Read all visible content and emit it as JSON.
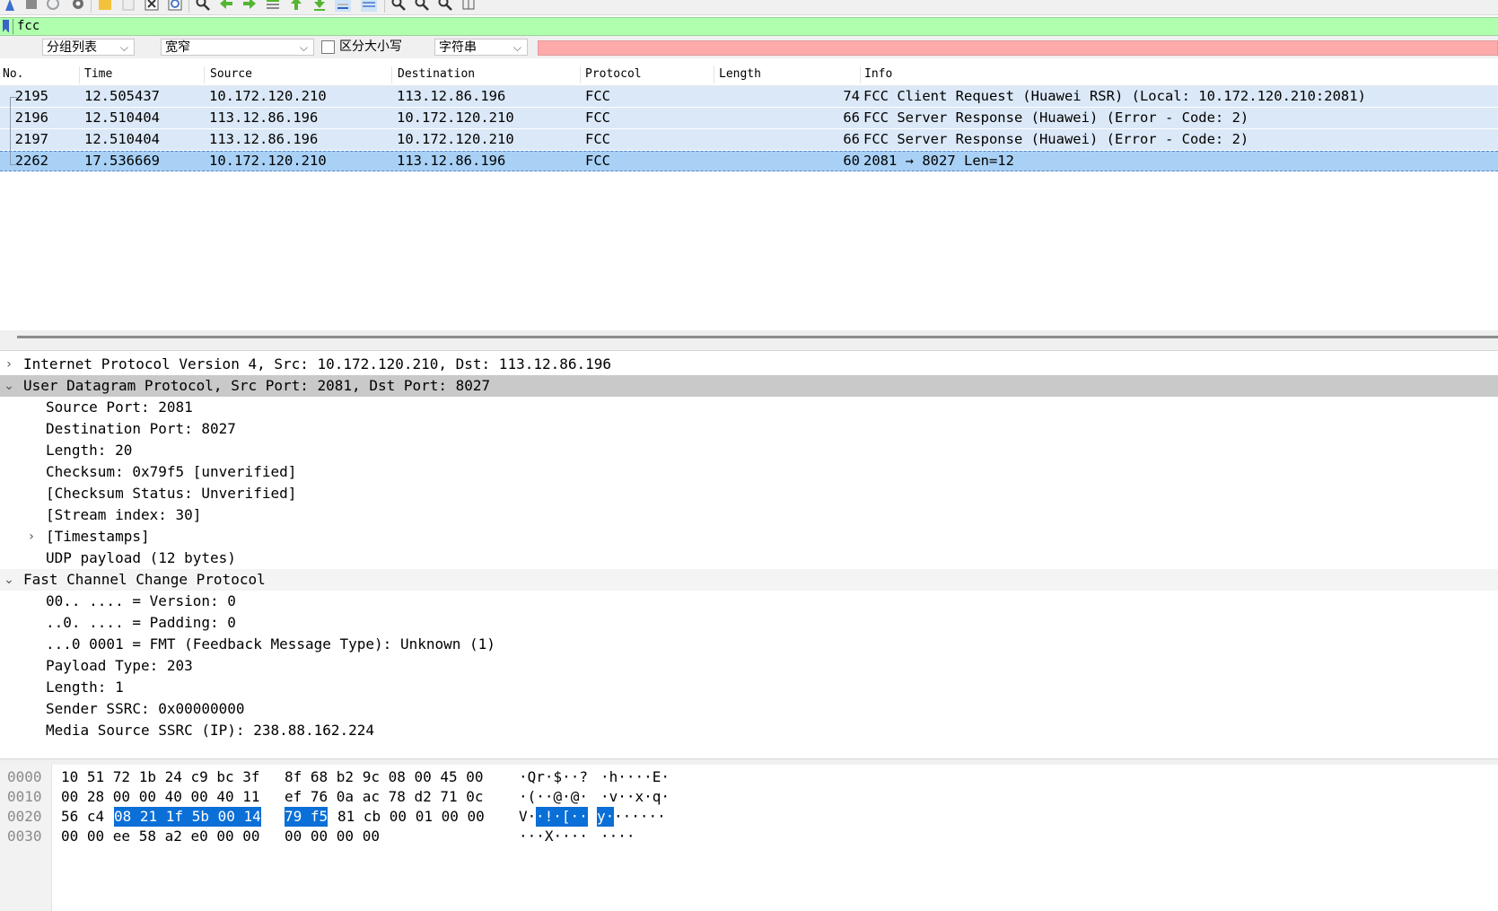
{
  "toolbar": {
    "icons": [
      "shark-fin-start-icon",
      "stop-capture-icon",
      "restart-capture-icon",
      "capture-options-icon",
      "open-file-icon",
      "save-file-icon",
      "close-file-icon",
      "reload-file-icon",
      "find-packet-icon",
      "go-back-icon",
      "go-forward-icon",
      "go-to-packet-icon",
      "go-first-icon",
      "go-last-icon",
      "autoscroll-icon",
      "colorize-icon",
      "zoom-in-icon",
      "zoom-out-icon",
      "normal-size-icon",
      "resize-columns-icon"
    ]
  },
  "filter": {
    "value": "fcc",
    "background": "#afffaf"
  },
  "search": {
    "scope": "分组列表",
    "charset": "宽窄",
    "case_label": "区分大小写",
    "type": "字符串",
    "field_background": "#ffaaaa"
  },
  "packet_list": {
    "columns": [
      "No.",
      "Time",
      "Source",
      "Destination",
      "Protocol",
      "Length",
      "Info"
    ],
    "rows": [
      {
        "no": "2195",
        "time": "12.505437",
        "src": "10.172.120.210",
        "dst": "113.12.86.196",
        "proto": "FCC",
        "len": "74",
        "info": "FCC Client Request (Huawei RSR) (Local: 10.172.120.210:2081)"
      },
      {
        "no": "2196",
        "time": "12.510404",
        "src": "113.12.86.196",
        "dst": "10.172.120.210",
        "proto": "FCC",
        "len": "66",
        "info": "FCC Server Response (Huawei) (Error - Code: 2)"
      },
      {
        "no": "2197",
        "time": "12.510404",
        "src": "113.12.86.196",
        "dst": "10.172.120.210",
        "proto": "FCC",
        "len": "66",
        "info": "FCC Server Response (Huawei) (Error - Code: 2)"
      },
      {
        "no": "2262",
        "time": "17.536669",
        "src": "10.172.120.210",
        "dst": "113.12.86.196",
        "proto": "FCC",
        "len": "60",
        "info": "2081 → 8027 Len=12"
      }
    ],
    "row_color": "#dbe8f7",
    "selected_color": "#a9d1f5"
  },
  "details": [
    "Internet Protocol Version 4, Src: 10.172.120.210, Dst: 113.12.86.196",
    "User Datagram Protocol, Src Port: 2081, Dst Port: 8027",
    "Source Port: 2081",
    "Destination Port: 8027",
    "Length: 20",
    "Checksum: 0x79f5 [unverified]",
    "[Checksum Status: Unverified]",
    "[Stream index: 30]",
    "[Timestamps]",
    "UDP payload (12 bytes)",
    "Fast Channel Change Protocol",
    "00.. .... = Version: 0",
    "..0. .... = Padding: 0",
    "...0 0001 = FMT (Feedback Message Type): Unknown (1)",
    "Payload Type: 203",
    "Length: 1",
    "Sender SSRC: 0x00000000",
    "Media Source SSRC (IP): 238.88.162.224"
  ],
  "hex": {
    "rows": [
      {
        "offset": "0000",
        "b1": "10 51 72 1b 24 c9 bc 3f",
        "b2": "8f 68 b2 9c 08 00 45 00",
        "ascii_a": "·Qr·$··?",
        "ascii_b": "·h····E·"
      },
      {
        "offset": "0010",
        "b1": "00 28 00 00 40 00 40 11",
        "b2": "ef 76 0a ac 78 d2 71 0c",
        "ascii_a": "·(··@·@·",
        "ascii_b": "·v··x·q·"
      },
      {
        "offset": "0020",
        "b1_pre": "56 c4",
        "b1_sel": "08 21 1f 5b 00 14",
        "b2_sel": "79 f5",
        "b2_post": "81 cb 00 01 00 00",
        "ascii_a_pre": "V·",
        "ascii_a_sel": "·!·[··",
        "ascii_b_sel": "y·",
        "ascii_b_post": "······"
      },
      {
        "offset": "0030",
        "b1": "00 00 ee 58 a2 e0 00 00",
        "b2": "00 00 00 00",
        "ascii_a": "···X····",
        "ascii_b": "····"
      }
    ],
    "highlight_color": "#0a6fd6"
  }
}
